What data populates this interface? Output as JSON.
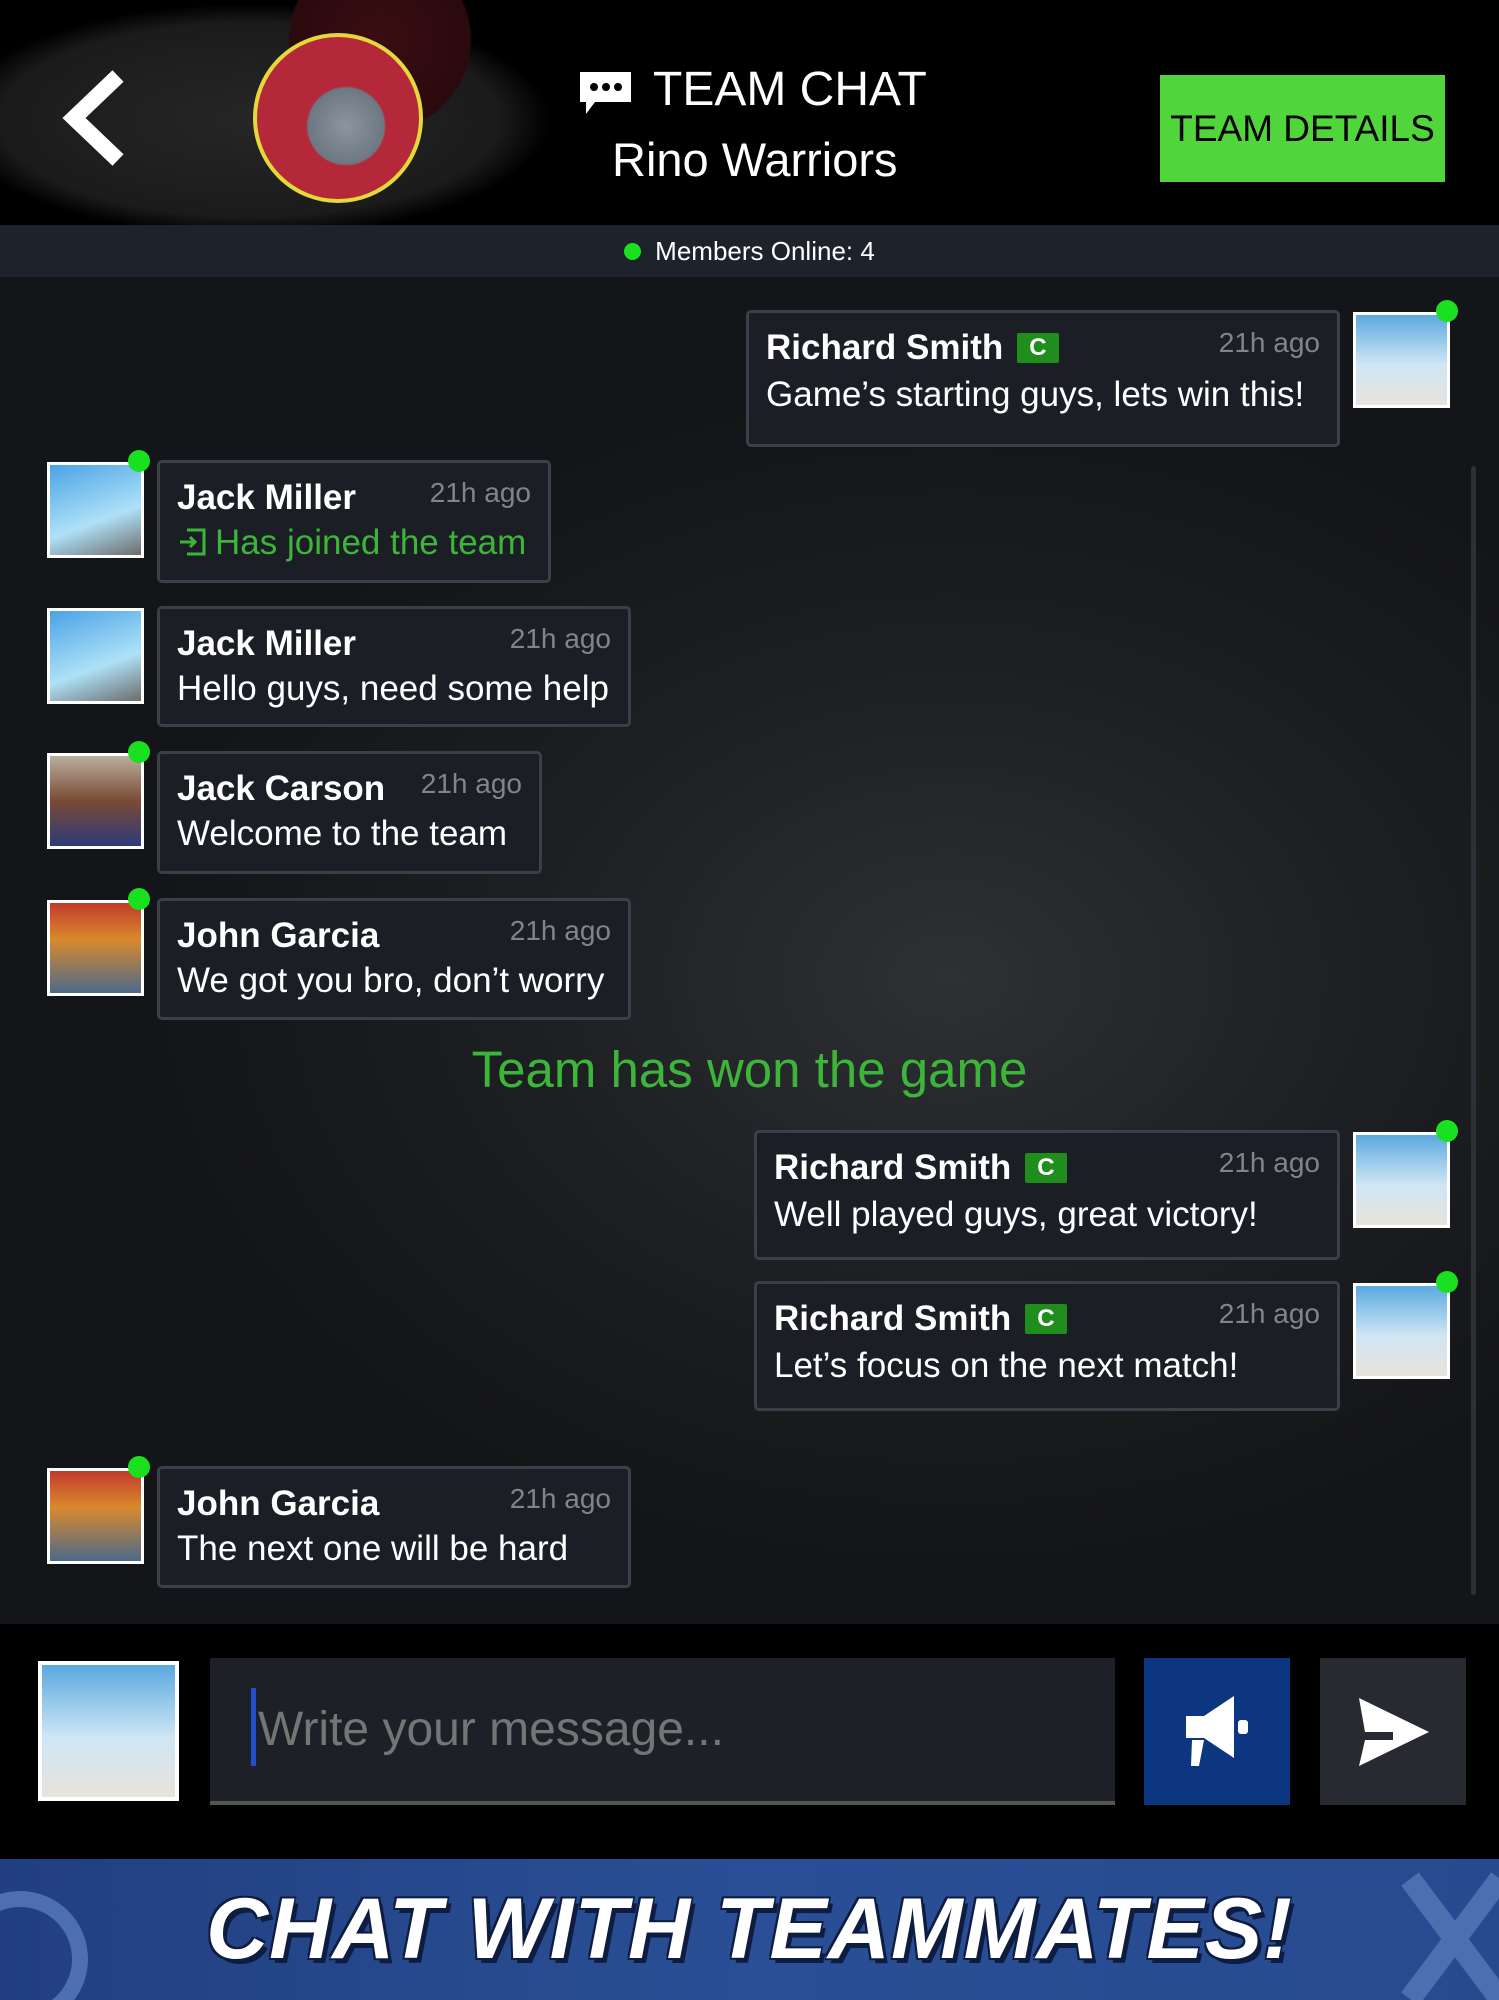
{
  "header": {
    "title": "TEAM CHAT",
    "team_name": "Rino Warriors",
    "details_label": "TEAM DETAILS",
    "members_online": "Members Online: 4"
  },
  "colors": {
    "accent_green": "#50d53a",
    "online": "#19e11f",
    "system_text": "#3db43a",
    "banner": "#2a4f96"
  },
  "messages": [
    {
      "side": "right",
      "name": "Richard Smith",
      "badge": "C",
      "time": "21h ago",
      "text": "Game’s starting guys, lets win this!",
      "avatar": "av-b",
      "online": true
    },
    {
      "side": "left",
      "name": "Jack Miller",
      "time": "21h ago",
      "text": "Has joined the team",
      "event": true,
      "icon": "enter-icon",
      "avatar": "av-a",
      "online": true
    },
    {
      "side": "left",
      "name": "Jack Miller",
      "time": "21h ago",
      "text": "Hello guys, need some help",
      "avatar": "av-a",
      "online": false
    },
    {
      "side": "left",
      "name": "Jack Carson",
      "time": "21h ago",
      "text": "Welcome to the team",
      "avatar": "av-c",
      "online": true
    },
    {
      "side": "left",
      "name": "John Garcia",
      "time": "21h ago",
      "text": "We got you bro, don’t worry",
      "avatar": "av-d",
      "online": true
    },
    {
      "side": "right",
      "name": "Richard Smith",
      "badge": "C",
      "time": "21h ago",
      "text": "Well played guys, great victory!",
      "avatar": "av-b",
      "online": true
    },
    {
      "side": "right",
      "name": "Richard Smith",
      "badge": "C",
      "time": "21h ago",
      "text": "Let’s focus on the next match!",
      "avatar": "av-b",
      "online": true
    },
    {
      "side": "left",
      "name": "John Garcia",
      "time": "21h ago",
      "text": "The next one will be hard",
      "avatar": "av-d",
      "online": true
    }
  ],
  "system_message": "Team has won the game",
  "composer": {
    "placeholder": "Write your message...",
    "value": ""
  },
  "banner": {
    "text": "CHAT WITH TEAMMATES!"
  }
}
